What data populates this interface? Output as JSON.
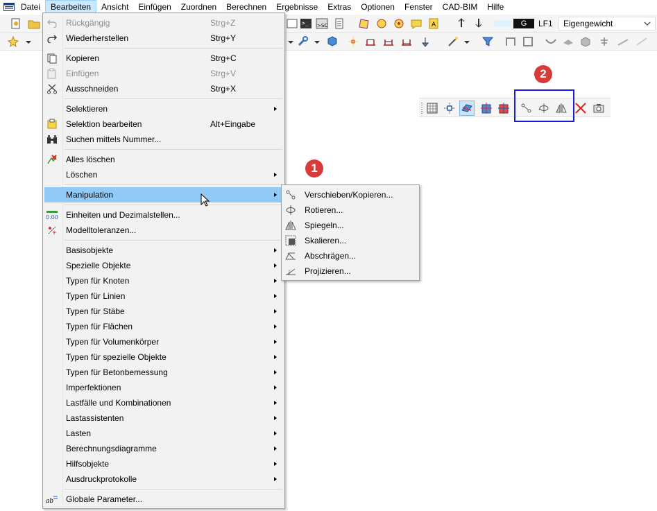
{
  "menubar": {
    "items": [
      "Datei",
      "Bearbeiten",
      "Ansicht",
      "Einfügen",
      "Zuordnen",
      "Berechnen",
      "Ergebnisse",
      "Extras",
      "Optionen",
      "Fenster",
      "CAD-BIM",
      "Hilfe"
    ],
    "active": "Bearbeiten"
  },
  "load_case": {
    "color_code": "G",
    "id": "LF1",
    "name": "Eigengewicht"
  },
  "edit_menu": {
    "undo": {
      "label": "Rückgängig",
      "shortcut": "Strg+Z",
      "enabled": false
    },
    "redo": {
      "label": "Wiederherstellen",
      "shortcut": "Strg+Y"
    },
    "copy": {
      "label": "Kopieren",
      "shortcut": "Strg+C"
    },
    "paste": {
      "label": "Einfügen",
      "shortcut": "Strg+V",
      "enabled": false
    },
    "cut": {
      "label": "Ausschneiden",
      "shortcut": "Strg+X"
    },
    "select": {
      "label": "Selektieren"
    },
    "edit_selection": {
      "label": "Selektion bearbeiten",
      "shortcut": "Alt+Eingabe"
    },
    "find_by_number": {
      "label": "Suchen mittels Nummer..."
    },
    "delete_all": {
      "label": "Alles löschen"
    },
    "delete": {
      "label": "Löschen"
    },
    "manipulation": {
      "label": "Manipulation"
    },
    "units": {
      "label": "Einheiten und Dezimalstellen..."
    },
    "tolerances": {
      "label": "Modelltoleranzen..."
    },
    "submenus": [
      "Basisobjekte",
      "Spezielle Objekte",
      "Typen für Knoten",
      "Typen für Linien",
      "Typen für Stäbe",
      "Typen für Flächen",
      "Typen für Volumenkörper",
      "Typen für spezielle Objekte",
      "Typen für Betonbemessung",
      "Imperfektionen",
      "Lastfälle und Kombinationen",
      "Lastassistenten",
      "Lasten",
      "Berechnungsdiagramme",
      "Hilfsobjekte",
      "Ausdruckprotokolle"
    ],
    "global_params": {
      "label": "Globale Parameter..."
    }
  },
  "manipulation_submenu": {
    "items": [
      "Verschieben/Kopieren...",
      "Rotieren...",
      "Spiegeln...",
      "Skalieren...",
      "Abschrägen...",
      "Projizieren..."
    ]
  },
  "callouts": [
    "1",
    "2"
  ],
  "colors": {
    "highlight": "#91c9f7",
    "callout": "#d93a3a",
    "frame": "#1a1adb"
  }
}
